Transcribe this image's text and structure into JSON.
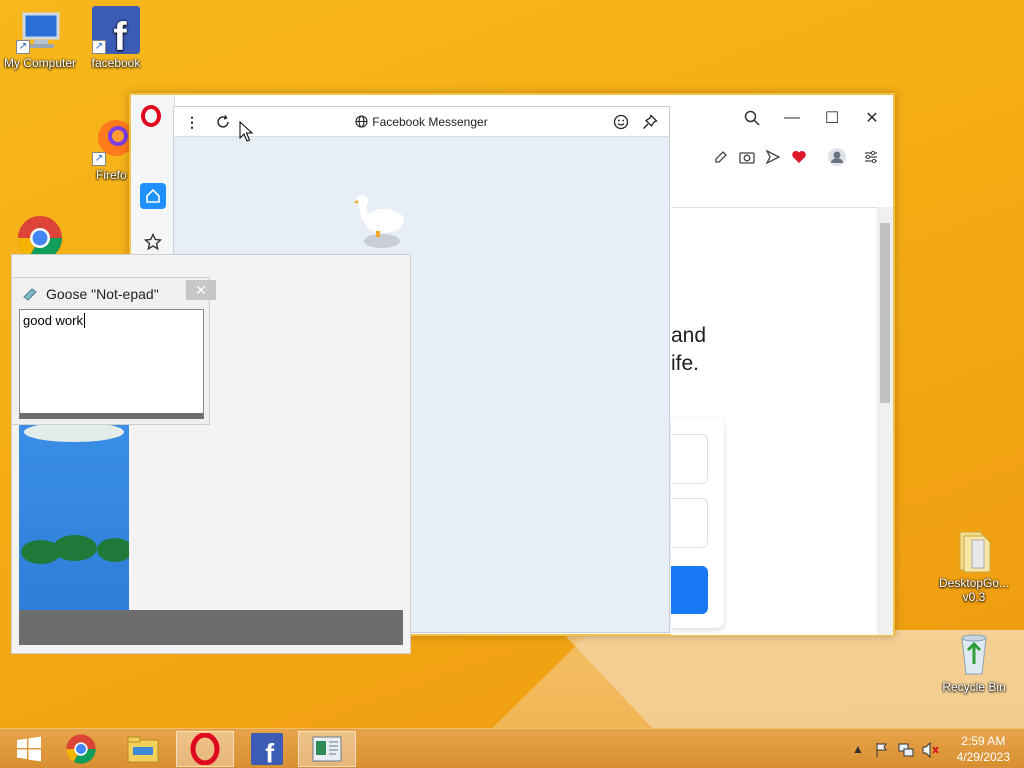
{
  "desktop": {
    "icons": [
      {
        "label": "My Computer"
      },
      {
        "label": "facebook"
      },
      {
        "label": "Firefo"
      },
      {
        "label": ""
      },
      {
        "label": "DesktopGo... v0.3"
      },
      {
        "label": "Recycle Bin"
      }
    ]
  },
  "browser": {
    "fb_text_line1": "and",
    "fb_text_line2": "ife."
  },
  "messenger": {
    "title": "Facebook Messenger"
  },
  "notepad": {
    "title": "Goose \"Not-epad\"",
    "close": "✕",
    "content": "good work"
  },
  "taskbar": {
    "time": "2:59 AM",
    "date": "4/29/2023"
  },
  "colors": {
    "opera_red": "#e0081f",
    "facebook_blue": "#1877f2",
    "accent_blue": "#1e90ff"
  }
}
